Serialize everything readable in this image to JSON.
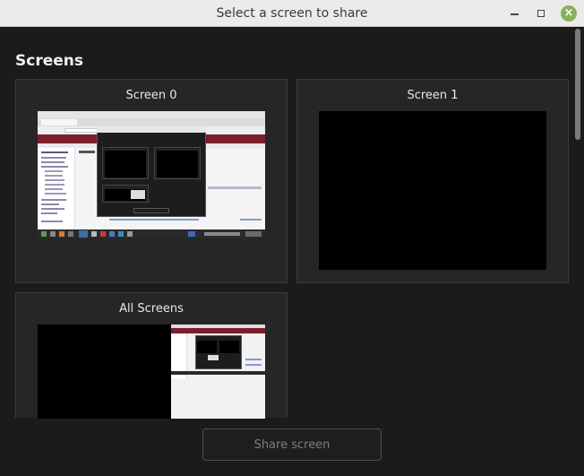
{
  "window": {
    "title": "Select a screen to share",
    "controls": [
      "minimize-icon",
      "maximize-icon",
      "close-icon"
    ],
    "accent": "#87b058"
  },
  "section": {
    "heading": "Screens"
  },
  "sources": [
    {
      "label": "Screen 0"
    },
    {
      "label": "Screen 1"
    },
    {
      "label": "All Screens"
    }
  ],
  "footer": {
    "share_label": "Share screen"
  }
}
